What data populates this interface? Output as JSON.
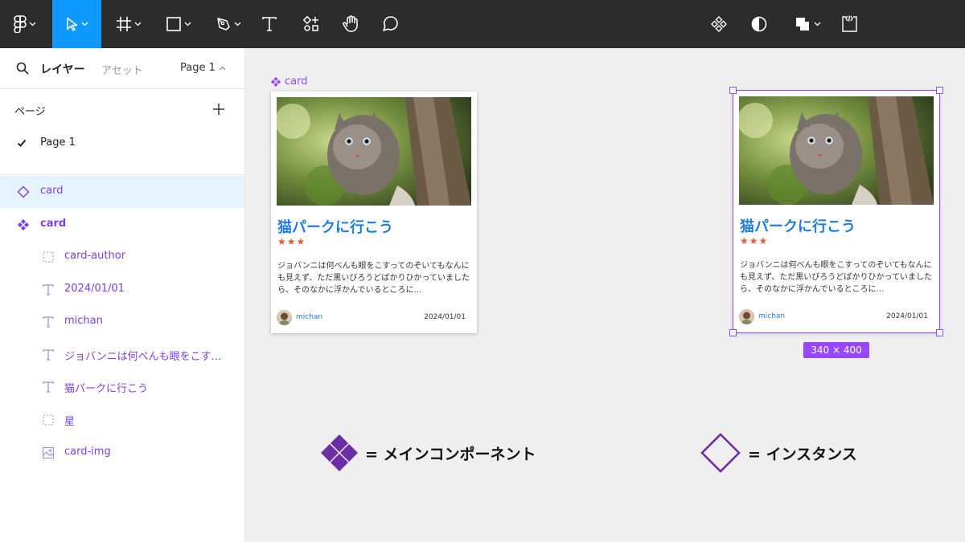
{
  "toolbar": {
    "tools": [
      {
        "name": "figma-menu"
      },
      {
        "name": "move-tool",
        "active": true
      },
      {
        "name": "frame-tool"
      },
      {
        "name": "shape-tool"
      },
      {
        "name": "pen-tool"
      },
      {
        "name": "text-tool"
      },
      {
        "name": "resources-tool"
      },
      {
        "name": "hand-tool"
      },
      {
        "name": "comment-tool"
      }
    ],
    "right_tools": [
      "component-icon",
      "contrast-icon",
      "boolean-icon",
      "dev-mode-icon"
    ],
    "active_color": "#0d99ff"
  },
  "panel": {
    "tab_layers": "レイヤー",
    "tab_assets": "アセット",
    "page_selector": "Page 1",
    "pages_header": "ページ",
    "current_page": "Page 1",
    "layers": [
      {
        "label": "card",
        "icon": "instance-icon",
        "selected": true
      },
      {
        "label": "card",
        "icon": "component-icon",
        "bold": true
      },
      {
        "label": "card-author",
        "icon": "group-dashed-icon"
      },
      {
        "label": "2024/01/01",
        "icon": "text-icon"
      },
      {
        "label": "michan",
        "icon": "text-icon"
      },
      {
        "label": "ジョバンニは何べんも眼をこす…",
        "icon": "text-icon"
      },
      {
        "label": "猫パークに行こう",
        "icon": "text-icon"
      },
      {
        "label": "星",
        "icon": "group-dashed-icon"
      },
      {
        "label": "card-img",
        "icon": "image-icon"
      }
    ]
  },
  "canvas": {
    "component_label": "card",
    "card": {
      "title": "猫パークに行こう",
      "stars": "★★★",
      "body": "ジョバンニは何べんも眼をこすってのぞいてもなんにも見えず、ただ黒いびろうどばかりひかっていましたら、そのなかに浮かんでいるところに…",
      "author": "michan",
      "date": "2024/01/01"
    },
    "dimension_badge": "340 × 400",
    "legend_main": "= メインコンポーネント",
    "legend_instance": "= インスタンス"
  },
  "colors": {
    "component_purple": "#9747ff",
    "title_blue": "#1f7de0",
    "star_orange": "#e85b30",
    "legend_purple": "#6b2fa3"
  }
}
